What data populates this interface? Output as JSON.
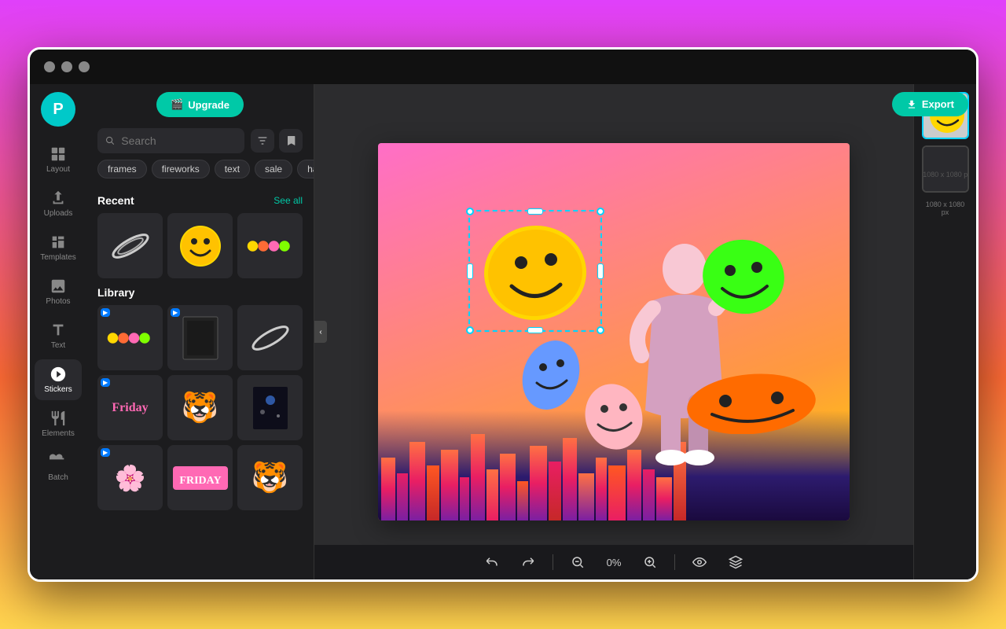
{
  "browser": {
    "dots": [
      "dot1",
      "dot2",
      "dot3"
    ]
  },
  "topbar": {
    "upgrade_label": "Upgrade",
    "export_label": "Export",
    "upgrade_icon": "⬆",
    "export_icon": "⬇"
  },
  "sidebar": {
    "items": [
      {
        "id": "layout",
        "label": "Layout",
        "icon": "layout"
      },
      {
        "id": "uploads",
        "label": "Uploads",
        "icon": "uploads"
      },
      {
        "id": "templates",
        "label": "Templates",
        "icon": "templates"
      },
      {
        "id": "photos",
        "label": "Photos",
        "icon": "photos"
      },
      {
        "id": "text",
        "label": "Text",
        "icon": "text"
      },
      {
        "id": "stickers",
        "label": "Stickers",
        "icon": "stickers",
        "active": true
      },
      {
        "id": "elements",
        "label": "Elements",
        "icon": "elements"
      },
      {
        "id": "batch",
        "label": "Batch",
        "icon": "batch"
      }
    ]
  },
  "stickers_panel": {
    "search_placeholder": "Search",
    "filter_tags": [
      "frames",
      "fireworks",
      "text",
      "sale",
      "happ"
    ],
    "recent_label": "Recent",
    "see_all_label": "See all",
    "library_label": "Library",
    "stickers_recent": [
      {
        "emoji": "🌀",
        "label": "swirl"
      },
      {
        "emoji": "😊",
        "label": "smiley-yellow"
      },
      {
        "emoji": "🟡🟠🟢",
        "label": "balls"
      }
    ],
    "stickers_library": [
      {
        "emoji": "🟡🟠🟢",
        "label": "neon-balls",
        "badge": "▶"
      },
      {
        "emoji": "🖼️",
        "label": "frame-dark",
        "badge": "▶"
      },
      {
        "emoji": "🌀",
        "label": "saturn"
      },
      {
        "emoji": "🎬",
        "label": "friday-text",
        "badge": "▶"
      },
      {
        "emoji": "🐯",
        "label": "tiger"
      },
      {
        "emoji": "🌌",
        "label": "space-frame"
      },
      {
        "emoji": "🌸",
        "label": "flowers",
        "badge": "▶"
      },
      {
        "emoji": "📅",
        "label": "friday-sticker"
      },
      {
        "emoji": "🐯",
        "label": "tiger2"
      }
    ]
  },
  "canvas": {
    "dimensions": "1080 x 1080 px",
    "zoom": "0%"
  },
  "toolbar": {
    "undo": "↩",
    "redo": "↪",
    "zoom_out": "−",
    "zoom_in": "+",
    "zoom_value": "0%",
    "eye": "👁",
    "layer": "⊞"
  }
}
